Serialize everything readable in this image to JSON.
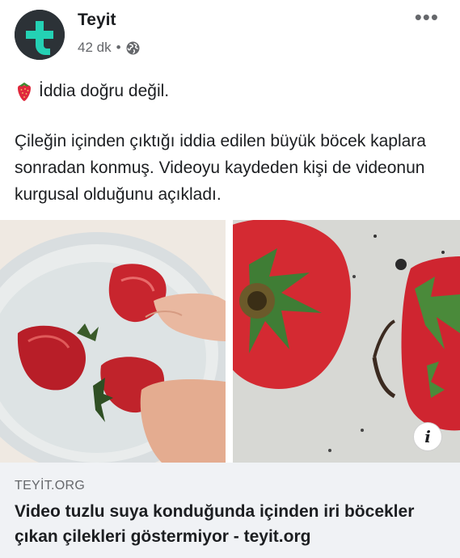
{
  "post": {
    "page_name": "Teyit",
    "time_ago": "42 dk",
    "separator": "•",
    "privacy_icon": "globe-icon",
    "more_label": "•••",
    "headline": "İddia doğru değil.",
    "headline_emoji": "strawberry-emoji",
    "body": "Çileğin içinden çıktığı iddia edilen büyük böcek kaplara sonradan konmuş. Videoyu kaydeden kişi de videonun kurgusal olduğunu açıkladı."
  },
  "media": {
    "left_image": "strawberries-in-bowl-of-water",
    "right_image": "strawberry-with-insect-closeup",
    "info_label": "i"
  },
  "link": {
    "domain": "TEYİT.ORG",
    "title": "Video tuzlu suya konduğunda içinden iri böcekler çıkan çilekleri göstermiyor - teyit.org"
  },
  "colors": {
    "avatar_bg": "#2c3237",
    "avatar_cross": "#24d1b4",
    "secondary_text": "#65676b",
    "card_bg": "#f0f2f5"
  }
}
